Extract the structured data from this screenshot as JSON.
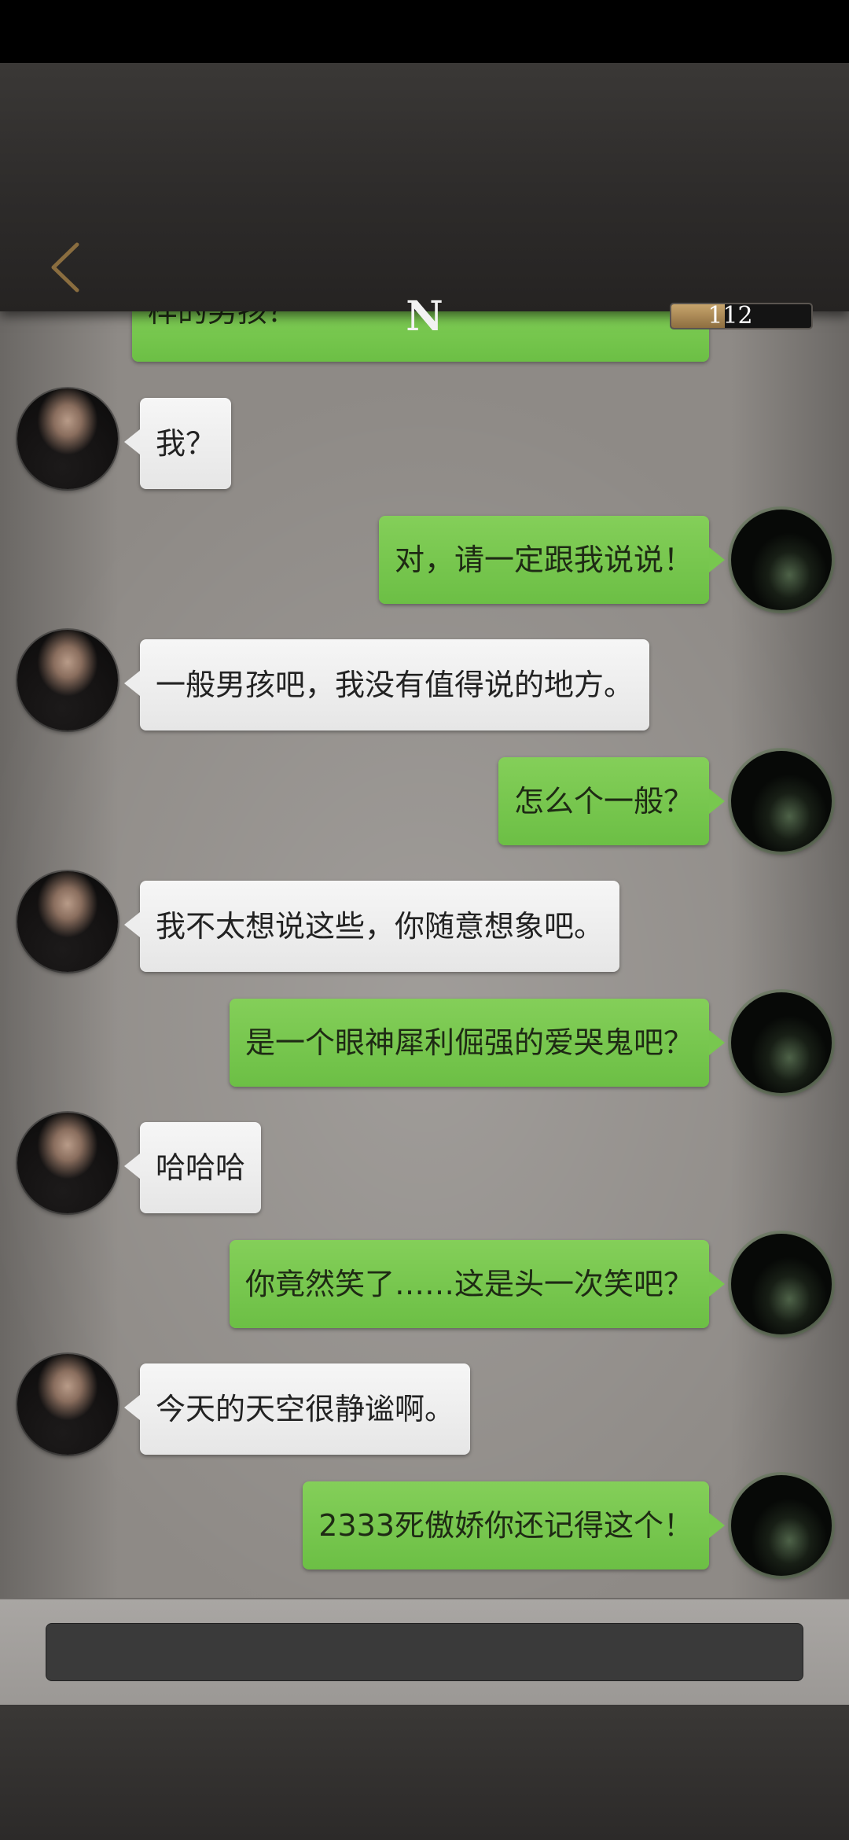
{
  "header": {
    "title": "N",
    "progress_value": "112",
    "progress_fraction": 0.38,
    "accent_color": "#a58452",
    "back_icon": "chevron-left-icon"
  },
  "chat": {
    "partial_message": "样的男孩？",
    "messages": [
      {
        "side": "left",
        "text": "我？"
      },
      {
        "side": "right",
        "text": "对，请一定跟我说说！"
      },
      {
        "side": "left",
        "text": "一般男孩吧，我没有值得说的地方。"
      },
      {
        "side": "right",
        "text": "怎么个一般？"
      },
      {
        "side": "left",
        "text": "我不太想说这些，你随意想象吧。"
      },
      {
        "side": "right",
        "text": "是一个眼神犀利倔强的爱哭鬼吧？"
      },
      {
        "side": "left",
        "text": "哈哈哈"
      },
      {
        "side": "right",
        "text": "你竟然笑了……这是头一次笑吧？"
      },
      {
        "side": "left",
        "text": "今天的天空很静谧啊。"
      },
      {
        "side": "right",
        "text": "2333死傲娇你还记得这个！"
      }
    ]
  },
  "input": {
    "value": ""
  },
  "colors": {
    "incoming_bubble": "#eeeeee",
    "outgoing_bubble": "#78c74f",
    "background": "#8e8a86"
  }
}
